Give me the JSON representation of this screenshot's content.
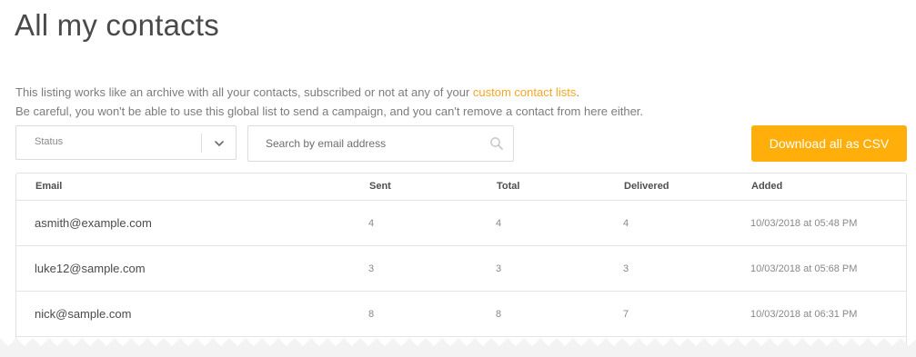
{
  "page": {
    "title": "All my contacts"
  },
  "description": {
    "line1_prefix": "This listing works like an archive with all your contacts, subscribed or not at any of your ",
    "line1_link": "custom contact lists",
    "line1_suffix": ".",
    "line2": "Be careful, you won't be able to use this global list to send a campaign, and you can't remove a contact from here either."
  },
  "filters": {
    "status_select": {
      "value": "Status",
      "icon": "chevron-down-icon"
    },
    "search": {
      "value": "",
      "placeholder": "Search by email address",
      "icon": "search-icon"
    }
  },
  "actions": {
    "download_label": "Download all as CSV"
  },
  "table": {
    "columns": [
      "Email",
      "Sent",
      "Total",
      "Delivered",
      "Added"
    ],
    "rows": [
      {
        "email": "asmith@example.com",
        "sent": "4",
        "total": "4",
        "delivered": "4",
        "added": "10/03/2018 at 05:48 PM"
      },
      {
        "email": "luke12@sample.com",
        "sent": "3",
        "total": "3",
        "delivered": "3",
        "added": "10/03/2018 at 05:68 PM"
      },
      {
        "email": "nick@sample.com",
        "sent": "8",
        "total": "8",
        "delivered": "7",
        "added": "10/03/2018 at 06:31 PM"
      }
    ]
  },
  "colors": {
    "accent": "#ffae0a",
    "link": "#f6a623",
    "title": "#4a4a4a",
    "muted_text": "#888888",
    "border": "#e2e2e2",
    "torn_edge_background": "#f2f3f2"
  }
}
